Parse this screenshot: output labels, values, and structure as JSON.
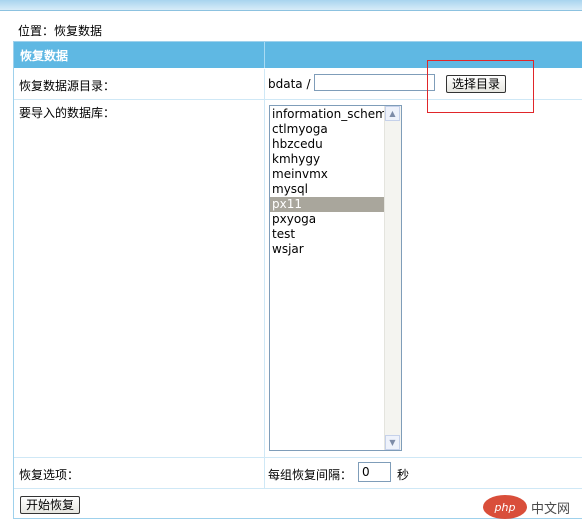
{
  "location": "位置：恢复数据",
  "panel": {
    "title": "恢复数据",
    "source_dir_label": "恢复数据源目录：",
    "dir_prefix": "bdata /",
    "dir_value": "",
    "select_dir_button": "选择目录",
    "import_db_label": "要导入的数据库：",
    "databases": [
      "information_schema",
      "ctlmyoga",
      "hbzcedu",
      "kmhygy",
      "meinvmx",
      "mysql",
      "px11",
      "pxyoga",
      "test",
      "wsjar"
    ],
    "selected_database": "px11",
    "options_label": "恢复选项：",
    "interval_label": "每组恢复间隔：",
    "interval_value": "0",
    "interval_unit": "秒",
    "start_button": "开始恢复"
  },
  "watermark": {
    "logo": "php",
    "text": "中文网"
  },
  "colors": {
    "header": "#5fb8e3",
    "highlight_box": "#e0262a",
    "selected_item": "#a9a69c"
  }
}
